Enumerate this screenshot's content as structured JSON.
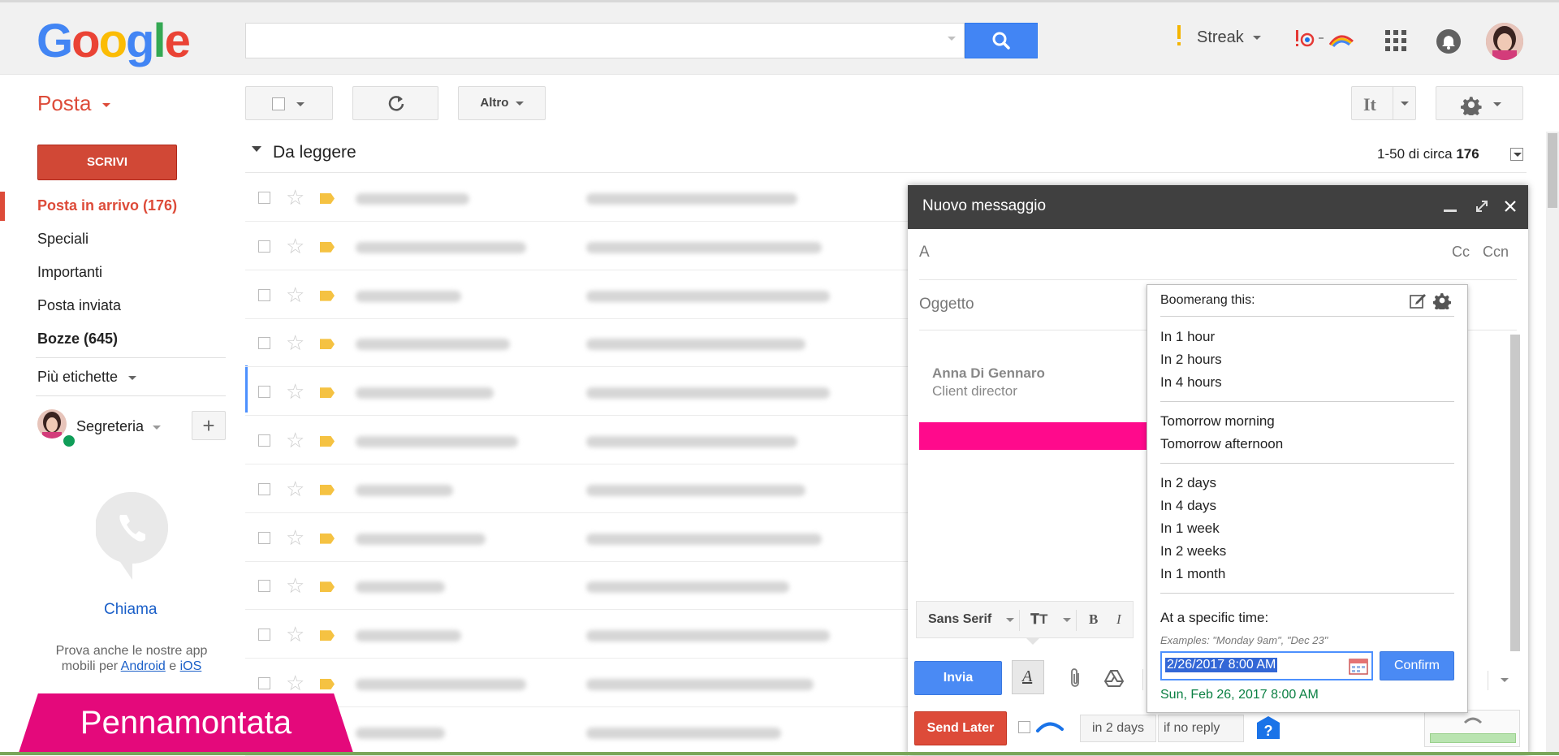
{
  "header": {
    "logo_letters": [
      {
        "ch": "G",
        "color": "#4285f4"
      },
      {
        "ch": "o",
        "color": "#ea4335"
      },
      {
        "ch": "o",
        "color": "#fbbc05"
      },
      {
        "ch": "g",
        "color": "#4285f4"
      },
      {
        "ch": "l",
        "color": "#34a853"
      },
      {
        "ch": "e",
        "color": "#ea4335"
      }
    ],
    "search_value": "",
    "streak_label": "Streak"
  },
  "toolbar": {
    "app_label": "Posta",
    "more_label": "Altro",
    "lang_label": "It"
  },
  "sidebar": {
    "compose_label": "SCRIVI",
    "items": [
      {
        "label": "Posta in arrivo (176)"
      },
      {
        "label": "Speciali"
      },
      {
        "label": "Importanti"
      },
      {
        "label": "Posta inviata"
      },
      {
        "label": "Bozze (645)"
      }
    ],
    "more_labels": "Più etichette",
    "hangouts_user": "Segreteria",
    "call_label": "Chiama",
    "promo_line1": "Prova anche le nostre app",
    "promo_line2_prefix": "mobili per",
    "promo_android": "Android",
    "promo_and": "e",
    "promo_ios": "iOS"
  },
  "list": {
    "section_title": "Da leggere",
    "range_prefix": "1-50 di circa",
    "range_total": "176"
  },
  "compose": {
    "title": "Nuovo messaggio",
    "to_label": "A",
    "cc_label": "Cc",
    "bcc_label": "Ccn",
    "subject_label": "Oggetto",
    "sig_name": "Anna Di Gennaro",
    "sig_role": "Client director",
    "font_label": "Sans Serif",
    "send_label": "Invia",
    "send_later_label": "Send Later",
    "delay_label": "in 2 days",
    "condition_label": "if no reply"
  },
  "boomerang": {
    "title": "Boomerang this:",
    "group1": [
      "In 1 hour",
      "In 2 hours",
      "In 4 hours"
    ],
    "group2": [
      "Tomorrow morning",
      "Tomorrow afternoon"
    ],
    "group3": [
      "In 2 days",
      "In 4 days",
      "In 1 week",
      "In 2 weeks",
      "In 1 month"
    ],
    "specific_label": "At a specific time:",
    "examples": "Examples: \"Monday 9am\", \"Dec 23\"",
    "datetime_value": "2/26/2017 8:00 AM",
    "confirm_label": "Confirm",
    "parsed_date": "Sun, Feb 26, 2017 8:00 AM"
  },
  "watermark": "Pennamontata",
  "colors": {
    "accent_red": "#dd4b39",
    "blue": "#4285f4",
    "green_text": "#0b8043",
    "magenta": "#e4097b"
  }
}
